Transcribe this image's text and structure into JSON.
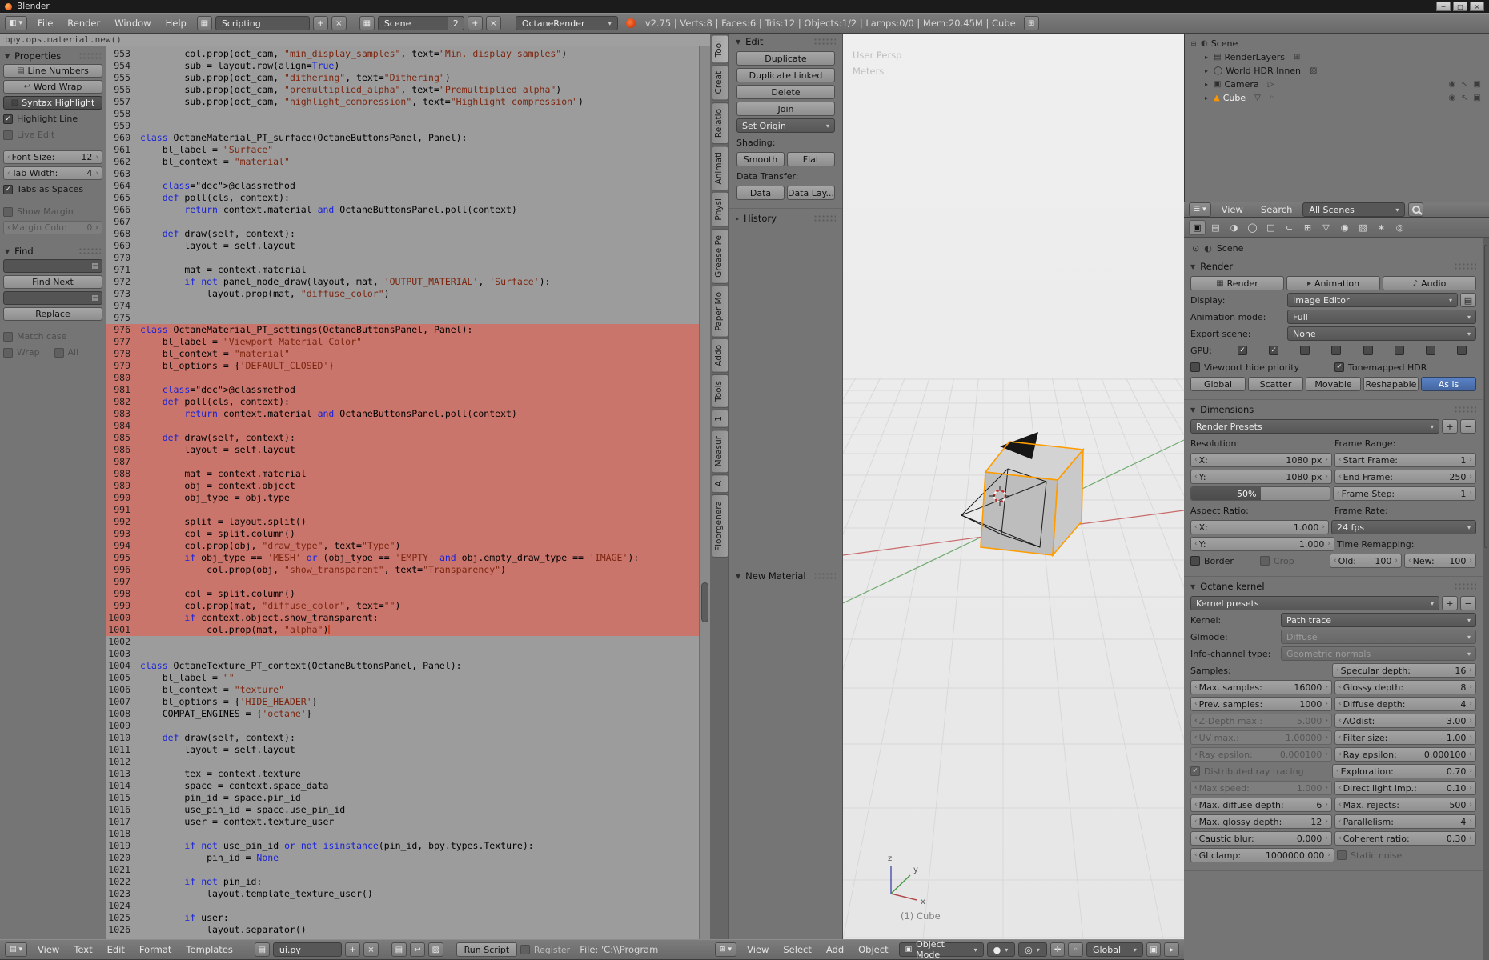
{
  "titlebar": {
    "title": "Blender",
    "window_buttons": [
      "─",
      "□",
      "×"
    ]
  },
  "menubar": {
    "menus": [
      "File",
      "Render",
      "Window",
      "Help"
    ],
    "layout": {
      "value": "Scripting"
    },
    "scene": {
      "value": "Scene",
      "count": "2"
    },
    "engine": {
      "value": "OctaneRender"
    },
    "stats": "v2.75 | Verts:8 | Faces:6 | Tris:12 | Objects:1/2 | Lamps:0/0 | Mem:20.45M | Cube"
  },
  "info_report": "bpy.ops.material.new()",
  "text_sidebar": {
    "properties_title": "Properties",
    "line_numbers": "Line Numbers",
    "word_wrap": "Word Wrap",
    "syntax_highlight": "Syntax Highlight",
    "highlight_line": "Highlight Line",
    "live_edit": "Live Edit",
    "font_size_label": "Font Size:",
    "font_size_value": "12",
    "tab_width_label": "Tab Width:",
    "tab_width_value": "4",
    "tabs_as_spaces": "Tabs as Spaces",
    "show_margin": "Show Margin",
    "margin_label": "Margin Colu:",
    "margin_value": "0",
    "find_title": "Find",
    "find_next": "Find Next",
    "replace": "Replace",
    "match_case": "Match case",
    "wrap": "Wrap",
    "all": "All"
  },
  "editor": {
    "first_line": 953,
    "highlight_from": 976,
    "highlight_to": 1001,
    "cursor_line": 1001,
    "lines": [
      "        col.prop(oct_cam, \"min_display_samples\", text=\"Min. display samples\")",
      "        sub = layout.row(align=True)",
      "        sub.prop(oct_cam, \"dithering\", text=\"Dithering\")",
      "        sub.prop(oct_cam, \"premultiplied_alpha\", text=\"Premultiplied alpha\")",
      "        sub.prop(oct_cam, \"highlight_compression\", text=\"Highlight compression\")",
      "",
      "",
      "class OctaneMaterial_PT_surface(OctaneButtonsPanel, Panel):",
      "    bl_label = \"Surface\"",
      "    bl_context = \"material\"",
      "",
      "    @classmethod",
      "    def poll(cls, context):",
      "        return context.material and OctaneButtonsPanel.poll(context)",
      "",
      "    def draw(self, context):",
      "        layout = self.layout",
      "",
      "        mat = context.material",
      "        if not panel_node_draw(layout, mat, 'OUTPUT_MATERIAL', 'Surface'):",
      "            layout.prop(mat, \"diffuse_color\")",
      "",
      "",
      "class OctaneMaterial_PT_settings(OctaneButtonsPanel, Panel):",
      "    bl_label = \"Viewport Material Color\"",
      "    bl_context = \"material\"",
      "    bl_options = {'DEFAULT_CLOSED'}",
      "",
      "    @classmethod",
      "    def poll(cls, context):",
      "        return context.material and OctaneButtonsPanel.poll(context)",
      "",
      "    def draw(self, context):",
      "        layout = self.layout",
      "",
      "        mat = context.material",
      "        obj = context.object",
      "        obj_type = obj.type",
      "",
      "        split = layout.split()",
      "        col = split.column()",
      "        col.prop(obj, \"draw_type\", text=\"Type\")",
      "        if obj_type == 'MESH' or (obj_type == 'EMPTY' and obj.empty_draw_type == 'IMAGE'):",
      "            col.prop(obj, \"show_transparent\", text=\"Transparency\")",
      "",
      "        col = split.column()",
      "        col.prop(mat, \"diffuse_color\", text=\"\")",
      "        if context.object.show_transparent:",
      "            col.prop(mat, \"alpha\")",
      "",
      "",
      "class OctaneTexture_PT_context(OctaneButtonsPanel, Panel):",
      "    bl_label = \"\"",
      "    bl_context = \"texture\"",
      "    bl_options = {'HIDE_HEADER'}",
      "    COMPAT_ENGINES = {'octane'}",
      "",
      "    def draw(self, context):",
      "        layout = self.layout",
      "",
      "        tex = context.texture",
      "        space = context.space_data",
      "        pin_id = space.pin_id",
      "        use_pin_id = space.use_pin_id",
      "        user = context.texture_user",
      "",
      "        if not use_pin_id or not isinstance(pin_id, bpy.types.Texture):",
      "            pin_id = None",
      "",
      "        if not pin_id:",
      "            layout.template_texture_user()",
      "",
      "        if user:",
      "            layout.separator()"
    ]
  },
  "editor_footer": {
    "menus": [
      "View",
      "Text",
      "Edit",
      "Format",
      "Templates"
    ],
    "datablock": "ui.py",
    "run": "Run Script",
    "register": "Register",
    "file": "File: 'C:\\\\Program"
  },
  "tool_tabs": [
    "Tool",
    "Creat",
    "Relatio",
    "Animati",
    "Physi",
    "Grease Pe",
    "Paper Mo",
    "Addo",
    "Tools",
    "1",
    "Measur",
    "A",
    "Floorgenera"
  ],
  "tool_shelf": {
    "edit": {
      "title": "Edit",
      "rows": [
        [
          {
            "t": "btn",
            "l": "Duplicate"
          }
        ],
        [
          {
            "t": "btn",
            "l": "Duplicate Linked"
          }
        ],
        [
          {
            "t": "btn",
            "l": "Delete"
          }
        ],
        [
          {
            "t": "btn",
            "l": "Join"
          }
        ],
        [
          {
            "t": "menu",
            "l": "Set Origin"
          }
        ],
        [
          {
            "t": "label",
            "l": "Shading:"
          }
        ],
        [
          {
            "t": "btn",
            "l": "Smooth"
          },
          {
            "t": "btn",
            "l": "Flat"
          }
        ],
        [
          {
            "t": "label",
            "l": "Data Transfer:"
          }
        ],
        [
          {
            "t": "btn",
            "l": "Data"
          },
          {
            "t": "btn",
            "l": "Data Lay..."
          }
        ]
      ]
    },
    "history": "History",
    "new_material": "New Material"
  },
  "viewport": {
    "persp_label": "User Persp",
    "unit_label": "Meters",
    "object_label": "(1) Cube",
    "axis": [
      "x",
      "y",
      "z"
    ]
  },
  "viewport_footer": {
    "menus": [
      "View",
      "Select",
      "Add",
      "Object"
    ],
    "mode_label": "Object Mode",
    "orientation_label": "Global"
  },
  "outliner": {
    "header": {
      "view": "View",
      "search": "Search",
      "display_mode": "All Scenes"
    },
    "items": [
      {
        "depth": 0,
        "expander": "⊟",
        "icon": {
          "name": "scene-icon",
          "glyph": "◐"
        },
        "label": "Scene",
        "extras": [],
        "rights": []
      },
      {
        "depth": 1,
        "expander": "▸",
        "icon": {
          "name": "renderlayers-icon",
          "glyph": "▤"
        },
        "label": "RenderLayers",
        "extras": [
          {
            "name": "image-icon",
            "glyph": "⊞"
          }
        ],
        "rights": []
      },
      {
        "depth": 1,
        "expander": "▸",
        "icon": {
          "name": "world-icon",
          "glyph": "◯"
        },
        "label": "World HDR Innen",
        "extras": [
          {
            "name": "texture-icon",
            "glyph": "▨"
          }
        ],
        "rights": []
      },
      {
        "depth": 1,
        "expander": "▸",
        "icon": {
          "name": "camera-icon",
          "glyph": "▣"
        },
        "label": "Camera",
        "extras": [
          {
            "name": "camera-data-icon",
            "glyph": "▷"
          }
        ],
        "rights": [
          {
            "name": "visibility-icon",
            "glyph": "◉"
          },
          {
            "name": "selectability-icon",
            "glyph": "↖"
          },
          {
            "name": "renderability-icon",
            "glyph": "▣"
          }
        ]
      },
      {
        "depth": 1,
        "expander": "▸",
        "icon": {
          "name": "mesh-icon",
          "glyph": "▲",
          "color": "#ff9600"
        },
        "label": "Cube",
        "label_color": "#f4f4f4",
        "extras": [
          {
            "name": "mesh-data-icon",
            "glyph": "▽"
          },
          {
            "name": "material-icon",
            "glyph": "◦"
          }
        ],
        "rights": [
          {
            "name": "visibility-icon",
            "glyph": "◉"
          },
          {
            "name": "selectability-icon",
            "glyph": "↖"
          },
          {
            "name": "renderability-icon",
            "glyph": "▣"
          }
        ]
      }
    ]
  },
  "props": {
    "tabs": [
      {
        "name": "render-tab",
        "glyph": "▣",
        "active": true
      },
      {
        "name": "render-layers-tab",
        "glyph": "▤"
      },
      {
        "name": "scene-tab",
        "glyph": "◑"
      },
      {
        "name": "world-tab",
        "glyph": "◯"
      },
      {
        "name": "object-tab",
        "glyph": "□"
      },
      {
        "name": "constraints-tab",
        "glyph": "⊂"
      },
      {
        "name": "modifiers-tab",
        "glyph": "⊞"
      },
      {
        "name": "object-data-tab",
        "glyph": "▽"
      },
      {
        "name": "material-tab",
        "glyph": "◉"
      },
      {
        "name": "texture-tab",
        "glyph": "▨"
      },
      {
        "name": "particles-tab",
        "glyph": "∗"
      },
      {
        "name": "physics-tab",
        "glyph": "◎"
      }
    ],
    "breadcrumb": "Scene",
    "accent_color": "#4a71b8",
    "panels": [
      {
        "title": "Render",
        "rows": [
          [
            {
              "t": "btn",
              "ic": "▦",
              "iname": "render-image-icon",
              "l": "Render"
            },
            {
              "t": "btn",
              "ic": "▸",
              "iname": "render-animation-icon",
              "l": "Animation"
            },
            {
              "t": "btn",
              "ic": "♪",
              "iname": "audio-icon",
              "l": "Audio"
            }
          ],
          [
            {
              "t": "label",
              "l": "Display:",
              "f": "0 0 118px"
            },
            {
              "t": "menu",
              "l": "Image Editor"
            },
            {
              "t": "icon",
              "ic": "▤",
              "name": "new-window-icon"
            }
          ],
          [
            {
              "t": "label",
              "l": "Animation mode:",
              "f": "0 0 118px"
            },
            {
              "t": "menu",
              "l": "Full"
            }
          ],
          [
            {
              "t": "label",
              "l": "Export scene:",
              "f": "0 0 118px"
            },
            {
              "t": "menu",
              "l": "None"
            }
          ],
          [
            {
              "t": "label",
              "l": "GPU:",
              "f": "0 0 44px"
            },
            {
              "t": "check",
              "on": true
            },
            {
              "t": "check",
              "on": true
            },
            {
              "t": "check"
            },
            {
              "t": "check"
            },
            {
              "t": "check"
            },
            {
              "t": "check"
            },
            {
              "t": "check"
            },
            {
              "t": "check"
            }
          ],
          [
            {
              "t": "check",
              "l": "Viewport hide priority"
            },
            {
              "t": "check",
              "l": "Tonemapped HDR",
              "on": true
            }
          ],
          [
            {
              "t": "btn",
              "l": "Global"
            },
            {
              "t": "btn",
              "l": "Scatter"
            },
            {
              "t": "btn",
              "l": "Movable"
            },
            {
              "t": "btn",
              "l": "Reshapable"
            },
            {
              "t": "btn",
              "l": "As is",
              "act": true
            }
          ]
        ]
      },
      {
        "title": "Dimensions",
        "rows": [
          [
            {
              "t": "menu",
              "l": "Render Presets"
            },
            {
              "t": "icon",
              "ic": "+",
              "name": "add-preset-button"
            },
            {
              "t": "icon",
              "ic": "−",
              "name": "remove-preset-button"
            }
          ],
          [
            {
              "t": "label",
              "l": "Resolution:"
            },
            {
              "t": "label",
              "l": "Frame Range:"
            }
          ],
          [
            {
              "t": "num",
              "l": "X:",
              "v": "1080 px"
            },
            {
              "t": "num",
              "l": "Start Frame:",
              "v": "1"
            }
          ],
          [
            {
              "t": "num",
              "l": "Y:",
              "v": "1080 px"
            },
            {
              "t": "num",
              "l": "End Frame:",
              "v": "250"
            }
          ],
          [
            {
              "t": "slider",
              "l": "50%",
              "fill": 50
            },
            {
              "t": "num",
              "l": "Frame Step:",
              "v": "1"
            }
          ],
          [
            {
              "t": "label",
              "l": "Aspect Ratio:"
            },
            {
              "t": "label",
              "l": "Frame Rate:"
            }
          ],
          [
            {
              "t": "num",
              "l": "X:",
              "v": "1.000"
            },
            {
              "t": "menu",
              "l": "24 fps"
            }
          ],
          [
            {
              "t": "num",
              "l": "Y:",
              "v": "1.000"
            },
            {
              "t": "label",
              "l": "Time Remapping:"
            }
          ],
          [
            {
              "t": "check",
              "l": "Border"
            },
            {
              "t": "check",
              "l": "Crop",
              "dim": true
            },
            {
              "t": "num",
              "l": "Old:",
              "v": "100"
            },
            {
              "t": "num",
              "l": "New:",
              "v": "100"
            }
          ]
        ]
      },
      {
        "title": "Octane kernel",
        "rows": [
          [
            {
              "t": "menu",
              "l": "Kernel presets"
            },
            {
              "t": "icon",
              "ic": "+",
              "name": "add-kernel-preset-button"
            },
            {
              "t": "icon",
              "ic": "−",
              "name": "remove-kernel-preset-button"
            }
          ],
          [
            {
              "t": "label",
              "l": "Kernel:",
              "f": "0 0 110px"
            },
            {
              "t": "menu",
              "l": "Path trace"
            }
          ],
          [
            {
              "t": "label",
              "l": "GImode:",
              "f": "0 0 110px"
            },
            {
              "t": "menu",
              "l": "Diffuse",
              "dim": true
            }
          ],
          [
            {
              "t": "label",
              "l": "Info-channel type:",
              "f": "0 0 110px"
            },
            {
              "t": "menu",
              "l": "Geometric normals",
              "dim": true
            }
          ],
          [
            {
              "t": "label",
              "l": "Samples:"
            },
            {
              "t": "num",
              "l": "Specular depth:",
              "v": "16"
            }
          ],
          [
            {
              "t": "num",
              "l": "Max. samples:",
              "v": "16000"
            },
            {
              "t": "num",
              "l": "Glossy depth:",
              "v": "8"
            }
          ],
          [
            {
              "t": "num",
              "l": "Prev. samples:",
              "v": "1000"
            },
            {
              "t": "num",
              "l": "Diffuse depth:",
              "v": "4"
            }
          ],
          [
            {
              "t": "num",
              "l": "Z-Depth max.:",
              "v": "5.000",
              "dim": true
            },
            {
              "t": "num",
              "l": "AOdist:",
              "v": "3.00"
            }
          ],
          [
            {
              "t": "num",
              "l": "UV max.:",
              "v": "1.00000",
              "dim": true
            },
            {
              "t": "num",
              "l": "Filter size:",
              "v": "1.00"
            }
          ],
          [
            {
              "t": "num",
              "l": "Ray epsilon:",
              "v": "0.000100",
              "dim": true
            },
            {
              "t": "num",
              "l": "Ray epsilon:",
              "v": "0.000100"
            }
          ],
          [
            {
              "t": "check",
              "l": "Distributed ray tracing",
              "on": true,
              "dim": true
            },
            {
              "t": "num",
              "l": "Exploration:",
              "v": "0.70"
            }
          ],
          [
            {
              "t": "num",
              "l": "Max speed:",
              "v": "1.000",
              "dim": true
            },
            {
              "t": "num",
              "l": "Direct light imp.:",
              "v": "0.10"
            }
          ],
          [
            {
              "t": "num",
              "l": "Max. diffuse depth:",
              "v": "6"
            },
            {
              "t": "num",
              "l": "Max. rejects:",
              "v": "500"
            }
          ],
          [
            {
              "t": "num",
              "l": "Max. glossy depth:",
              "v": "12"
            },
            {
              "t": "num",
              "l": "Parallelism:",
              "v": "4"
            }
          ],
          [
            {
              "t": "num",
              "l": "Caustic blur:",
              "v": "0.000"
            },
            {
              "t": "num",
              "l": "Coherent ratio:",
              "v": "0.30"
            }
          ],
          [
            {
              "t": "num",
              "l": "GI clamp:",
              "v": "1000000.000"
            },
            {
              "t": "check",
              "l": "Static noise",
              "dim": true
            }
          ]
        ]
      }
    ]
  }
}
